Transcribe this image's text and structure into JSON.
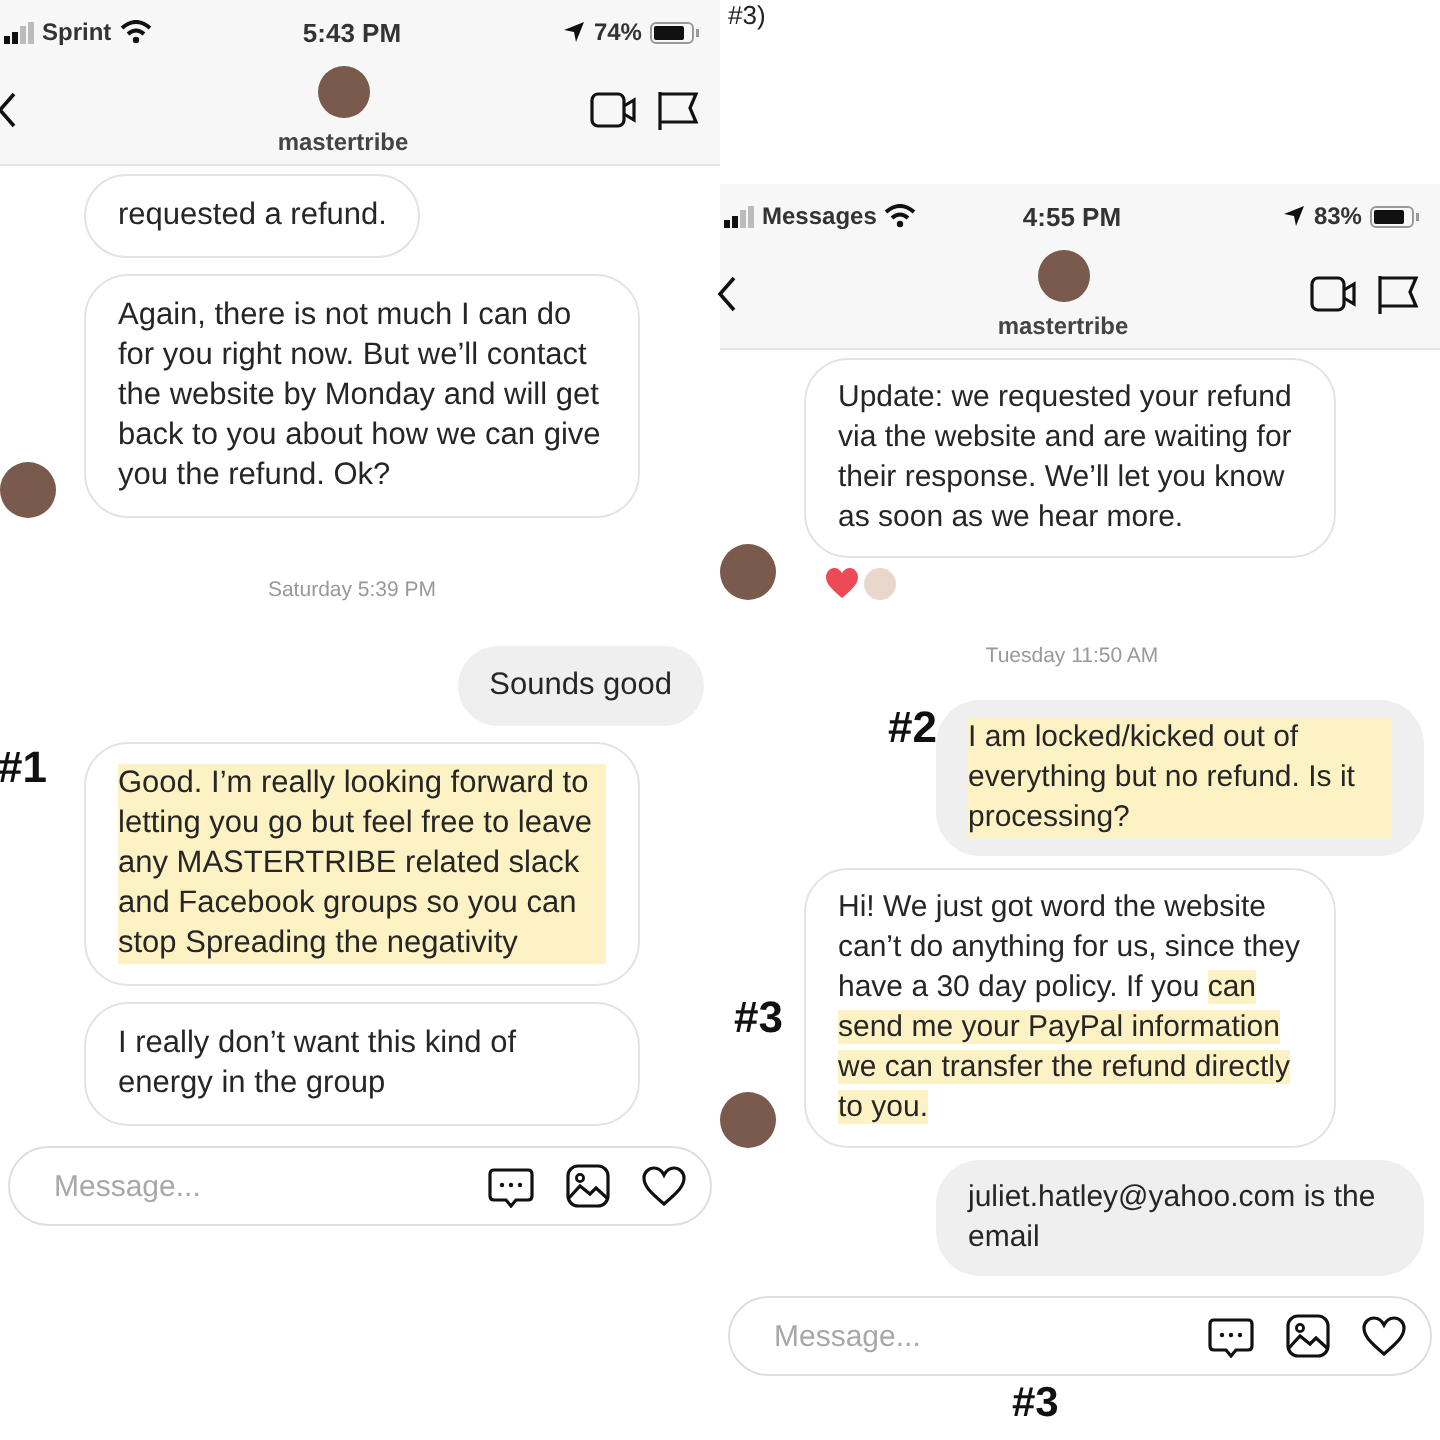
{
  "fragment": "#3)",
  "phones": [
    {
      "status_bar": {
        "carrier": "Sprint",
        "time": "5:43 PM",
        "battery": "74%"
      },
      "header": {
        "username": "mastertribe"
      },
      "messages": [
        {
          "kind": "received",
          "avatar": false,
          "reacted": false,
          "parts": [
            {
              "text": "requested a refund.",
              "highlighted": false
            }
          ]
        },
        {
          "kind": "received",
          "avatar": true,
          "reacted": false,
          "parts": [
            {
              "text": "Again, there is not much I can do for you right now. But we’ll contact the website by Monday and will get back to you about how we can give you the refund. Ok?",
              "highlighted": false
            }
          ]
        },
        {
          "kind": "timestamp",
          "text": "Saturday 5:39 PM"
        },
        {
          "kind": "sent",
          "parts": [
            {
              "text": "Sounds good",
              "highlighted": false
            }
          ]
        },
        {
          "kind": "received",
          "avatar": false,
          "reacted": false,
          "annotation": "#1",
          "parts": [
            {
              "text": "Good. I’m really looking forward to letting you go but feel free to leave any MASTERTRIBE related slack and Facebook groups so you can stop Spreading the negativity",
              "highlighted": true
            }
          ]
        },
        {
          "kind": "received",
          "avatar": false,
          "reacted": false,
          "parts": [
            {
              "text": "I really don’t want this kind of energy in the group",
              "highlighted": false
            }
          ]
        }
      ],
      "composer": {
        "placeholder": "Message..."
      }
    },
    {
      "status_bar": {
        "carrier": "Messages",
        "time": "4:55 PM",
        "battery": "83%"
      },
      "header": {
        "username": "mastertribe"
      },
      "messages": [
        {
          "kind": "received",
          "avatar": true,
          "reacted": true,
          "parts": [
            {
              "text": "Update: we requested your refund via the website and are waiting for their response. We’ll let you know as soon as we hear more.",
              "highlighted": false
            }
          ]
        },
        {
          "kind": "timestamp",
          "text": "Tuesday 11:50 AM"
        },
        {
          "kind": "sent",
          "annotation": "#2",
          "parts": [
            {
              "text": "I am locked/kicked out of everything but no refund. Is it processing?",
              "highlighted": true
            }
          ]
        },
        {
          "kind": "received",
          "avatar": true,
          "reacted": false,
          "annotation": "#3",
          "parts": [
            {
              "text": "Hi! We just got word the website can’t do anything for us, since they have a 30 day policy. If you ",
              "highlighted": false
            },
            {
              "text": "can send me your PayPal information we can transfer the refund directly to you.",
              "highlighted": true
            }
          ]
        },
        {
          "kind": "sent",
          "parts": [
            {
              "text": "juliet.hatley@yahoo.com is the email",
              "highlighted": false
            }
          ]
        }
      ],
      "composer": {
        "placeholder": "Message...",
        "annotation": "#3"
      }
    }
  ]
}
